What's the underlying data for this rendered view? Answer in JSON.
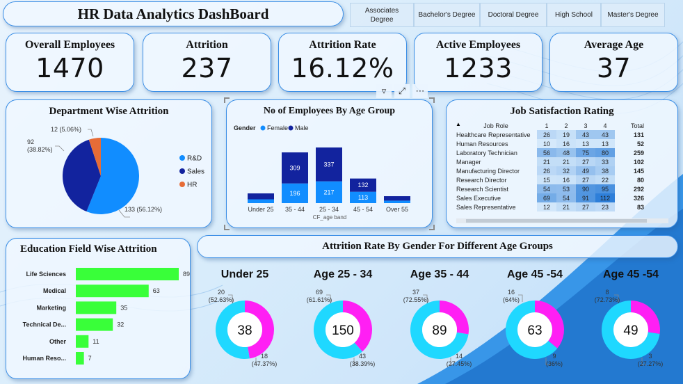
{
  "header": {
    "title": "HR Data Analytics DashBoard"
  },
  "slicer": {
    "items": [
      {
        "label": "Associates Degree"
      },
      {
        "label": "Bachelor's Degree"
      },
      {
        "label": "Doctoral Degree"
      },
      {
        "label": "High School"
      },
      {
        "label": "Master's Degree"
      }
    ]
  },
  "kpis": [
    {
      "label": "Overall Employees",
      "value": "1470"
    },
    {
      "label": "Attrition",
      "value": "237"
    },
    {
      "label": "Attrition Rate",
      "value": "16.12%"
    },
    {
      "label": "Active Employees",
      "value": "1233"
    },
    {
      "label": "Average Age",
      "value": "37"
    }
  ],
  "colors": {
    "rd": "#118dff",
    "sales": "#12239e",
    "hr": "#e66c37",
    "female": "#118dff",
    "male": "#12239e",
    "bar_green": "#39ff39",
    "donut_cyan": "#1fd8ff",
    "donut_magenta": "#ff1ff4",
    "heat_light": "#d5e9fb",
    "heat_dark": "#2e7fd9"
  },
  "chart_data": [
    {
      "type": "pie",
      "title": "Department Wise Attrition",
      "slices": [
        {
          "name": "R&D",
          "value": 133,
          "label": "133 (56.12%)"
        },
        {
          "name": "Sales",
          "value": 92,
          "label": "92 (38.82%)"
        },
        {
          "name": "HR",
          "value": 12,
          "label": "12 (5.06%)"
        }
      ],
      "legend": "right"
    },
    {
      "type": "bar",
      "stacked": true,
      "title": "No of Employees By Age Group",
      "legend_title": "Gender",
      "xlabel": "CF_age band",
      "categories": [
        "Under 25",
        "35 - 44",
        "25 - 34",
        "45 - 54",
        "Over 55"
      ],
      "series": [
        {
          "name": "Female",
          "values": [
            38,
            196,
            217,
            113,
            25
          ]
        },
        {
          "name": "Male",
          "values": [
            59,
            309,
            337,
            132,
            44
          ]
        }
      ],
      "data_labels": true,
      "legend": "top-left"
    },
    {
      "type": "table",
      "title": "Job Satisfaction Rating",
      "columns": [
        "Job Role",
        "1",
        "2",
        "3",
        "4",
        "Total"
      ],
      "rows": [
        [
          "Healthcare Representative",
          26,
          19,
          43,
          43,
          131
        ],
        [
          "Human Resources",
          10,
          16,
          13,
          13,
          52
        ],
        [
          "Laboratory Technician",
          56,
          48,
          75,
          80,
          259
        ],
        [
          "Manager",
          21,
          21,
          27,
          33,
          102
        ],
        [
          "Manufacturing Director",
          26,
          32,
          49,
          38,
          145
        ],
        [
          "Research Director",
          15,
          16,
          27,
          22,
          80
        ],
        [
          "Research Scientist",
          54,
          53,
          90,
          95,
          292
        ],
        [
          "Sales Executive",
          69,
          54,
          91,
          112,
          326
        ],
        [
          "Sales Representative",
          12,
          21,
          27,
          23,
          83
        ]
      ]
    },
    {
      "type": "bar",
      "orientation": "horizontal",
      "title": "Education Field Wise Attrition",
      "categories": [
        "Life Sciences",
        "Medical",
        "Marketing",
        "Technical De...",
        "Other",
        "Human Reso..."
      ],
      "values": [
        89,
        63,
        35,
        32,
        11,
        7
      ],
      "data_labels": true
    },
    {
      "type": "pie",
      "donut": true,
      "group_title": "Attrition Rate By Gender For Different Age Groups",
      "charts": [
        {
          "title": "Under 25",
          "center": "38",
          "male": 20,
          "male_label": "(52.63%)",
          "female": 18,
          "female_label": "(47.37%)"
        },
        {
          "title": "Age 25 - 34",
          "center": "150",
          "male": 69,
          "male_label": "(61.61%)",
          "female": 43,
          "female_label": "(38.39%)"
        },
        {
          "title": "Age 35 - 44",
          "center": "89",
          "male": 37,
          "male_label": "(72.55%)",
          "female": 14,
          "female_label": "(27.45%)"
        },
        {
          "title": "Age 45 -54",
          "center": "63",
          "male": 16,
          "male_label": "(64%)",
          "female": 9,
          "female_label": "(36%)"
        },
        {
          "title": "Age 45 -54",
          "center": "49",
          "male": 8,
          "male_label": "(72.73%)",
          "female": 3,
          "female_label": "(27.27%)"
        }
      ]
    }
  ]
}
